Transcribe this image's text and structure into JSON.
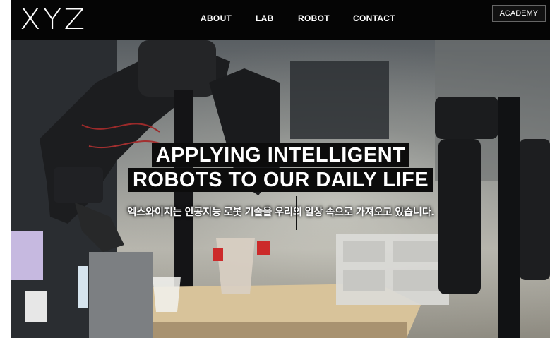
{
  "header": {
    "logo": "XYZ",
    "nav": [
      "ABOUT",
      "LAB",
      "ROBOT",
      "CONTACT"
    ],
    "academy_label": "ACADEMY"
  },
  "hero": {
    "title_line1": "APPLYING INTELLIGENT",
    "title_line2": "ROBOTS TO OUR DAILY LIFE",
    "subtitle": "엑스와이지는 인공지능 로봇 기술을 우리의 일상 속으로 가져오고 있습니다."
  },
  "colors": {
    "header_bg": "#050505",
    "title_bg": "#0c0c0c",
    "text": "#ffffff"
  }
}
